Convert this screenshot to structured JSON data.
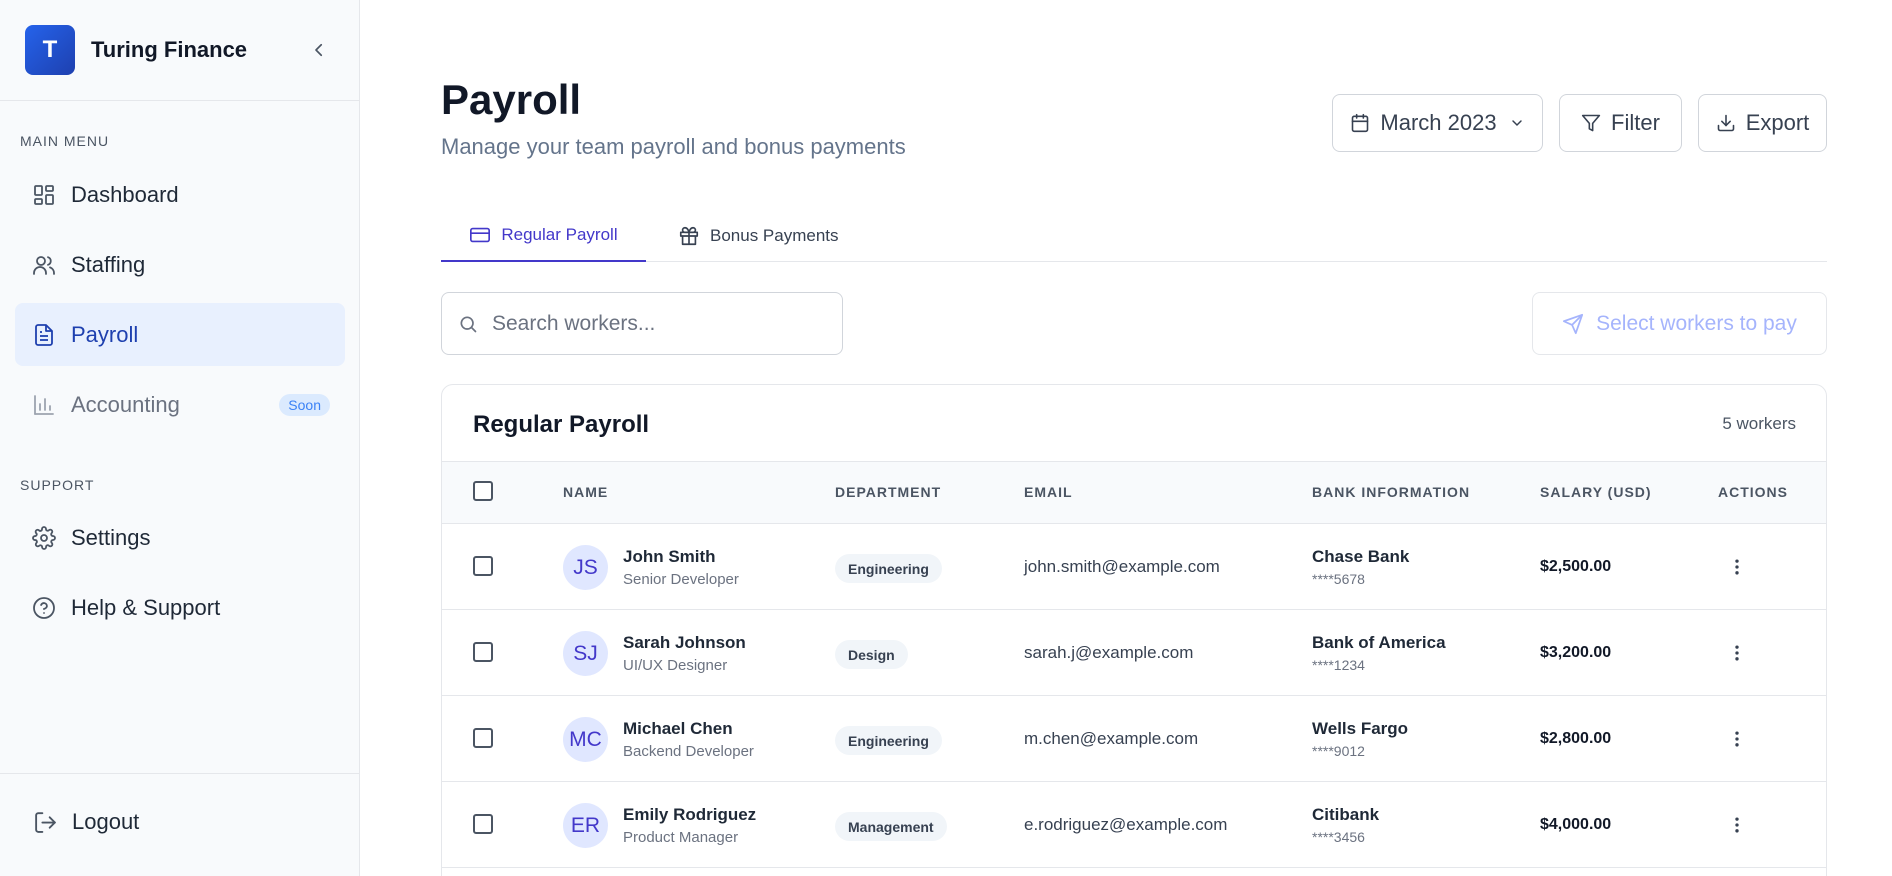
{
  "brand": {
    "logo_letter": "T",
    "name": "Turing Finance"
  },
  "sidebar": {
    "main_menu_label": "MAIN MENU",
    "support_label": "SUPPORT",
    "items": [
      {
        "label": "Dashboard",
        "icon": "dashboard-icon",
        "active": false
      },
      {
        "label": "Staffing",
        "icon": "users-icon",
        "active": false
      },
      {
        "label": "Payroll",
        "icon": "document-icon",
        "active": true
      },
      {
        "label": "Accounting",
        "icon": "bar-chart-icon",
        "active": false,
        "badge": "Soon"
      }
    ],
    "support_items": [
      {
        "label": "Settings",
        "icon": "gear-icon"
      },
      {
        "label": "Help & Support",
        "icon": "help-circle-icon"
      }
    ],
    "logout_label": "Logout"
  },
  "header": {
    "title": "Payroll",
    "subtitle": "Manage your team payroll and bonus payments",
    "month_label": "March 2023",
    "filter_label": "Filter",
    "export_label": "Export"
  },
  "tabs": [
    {
      "label": "Regular Payroll",
      "active": true
    },
    {
      "label": "Bonus Payments",
      "active": false
    }
  ],
  "search": {
    "placeholder": "Search workers...",
    "value": ""
  },
  "pay_button_label": "Select workers to pay",
  "table": {
    "title": "Regular Payroll",
    "count_label": "5 workers",
    "columns": [
      "NAME",
      "DEPARTMENT",
      "EMAIL",
      "BANK INFORMATION",
      "SALARY (USD)",
      "ACTIONS"
    ],
    "rows": [
      {
        "initials": "JS",
        "name": "John Smith",
        "role": "Senior Developer",
        "department": "Engineering",
        "email": "john.smith@example.com",
        "bank": "Chase Bank",
        "account": "****5678",
        "salary": "$2,500.00"
      },
      {
        "initials": "SJ",
        "name": "Sarah Johnson",
        "role": "UI/UX Designer",
        "department": "Design",
        "email": "sarah.j@example.com",
        "bank": "Bank of America",
        "account": "****1234",
        "salary": "$3,200.00"
      },
      {
        "initials": "MC",
        "name": "Michael Chen",
        "role": "Backend Developer",
        "department": "Engineering",
        "email": "m.chen@example.com",
        "bank": "Wells Fargo",
        "account": "****9012",
        "salary": "$2,800.00"
      },
      {
        "initials": "ER",
        "name": "Emily Rodriguez",
        "role": "Product Manager",
        "department": "Management",
        "email": "e.rodriguez@example.com",
        "bank": "Citibank",
        "account": "****3456",
        "salary": "$4,000.00"
      }
    ]
  },
  "colors": {
    "accent": "#4338ca",
    "brand": "#1e40af",
    "active_bg": "#e8f0fe"
  }
}
